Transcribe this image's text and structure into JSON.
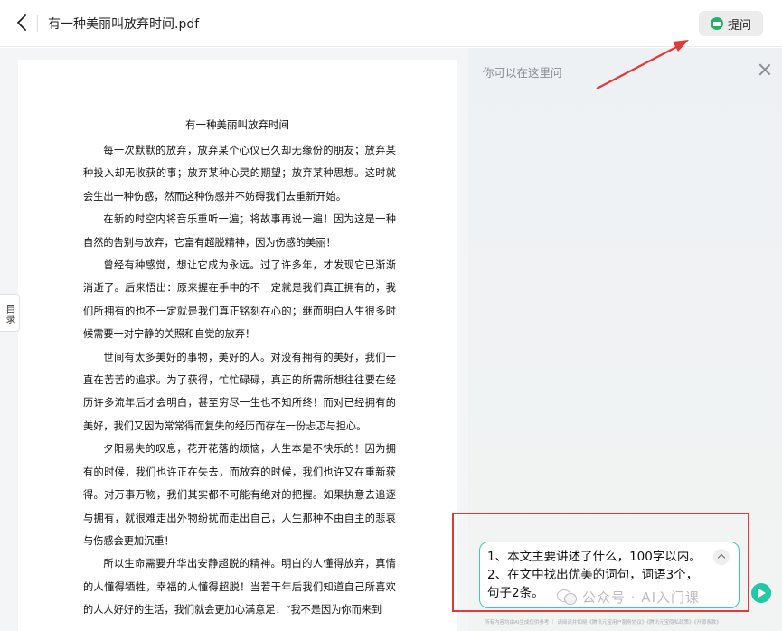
{
  "header": {
    "title": "有一种美丽叫放弃时间.pdf",
    "ask_label": "提问"
  },
  "sidebar": {
    "toc_label": "目录"
  },
  "document": {
    "heading": "有一种美丽叫放弃时间",
    "paragraphs": [
      "每一次默默的放弃，放弃某个心仪已久却无缘份的朋友；放弃某种投入却无收获的事；放弃某种心灵的期望；放弃某种思想。这时就会生出一种伤感，然而这种伤感并不妨碍我们去重新开始。",
      "在新的时空内将音乐重听一遍；将故事再说一遍！因为这是一种自然的告别与放弃，它富有超脱精神，因为伤感的美丽！",
      "曾经有种感觉，想让它成为永远。过了许多年，才发现它已渐渐消逝了。后来悟出：原来握在手中的不一定就是我们真正拥有的，我们所拥有的也不一定就是我们真正铭刻在心的；继而明白人生很多时候需要一对宁静的关照和自觉的放弃！",
      "世间有太多美好的事物，美好的人。对没有拥有的美好，我们一直在苦苦的追求。为了获得，忙忙碌碌，真正的所需所想往往要在经历许多流年后才会明白，甚至穷尽一生也不知所终！而对已经拥有的美好，我们又因为常常得而复失的经历而存在一份忐忑与担心。",
      "夕阳易失的叹息，花开花落的烦恼，人生本是不快乐的！因为拥有的时候，我们也许正在失去，而放弃的时候，我们也许又在重新获得。对万事万物，我们其实都不可能有绝对的把握。如果执意去追逐与拥有，就很难走出外物纷扰而走出自己，人生那种不由自主的悲哀与伤感会更加沉重！",
      "所以生命需要升华出安静超脱的精神。明白的人懂得放弃，真情的人懂得牺牲，幸福的人懂得超脱！当若干年后我们知道自己所喜欢的人人好好的生活，我们就会更加心满意足：“我不是因为你而来到"
    ]
  },
  "panel": {
    "hint": "你可以在这里问",
    "input_lines": [
      "1、本文主要讲述了什么，100字以内。",
      "2、在文中找出优美的词句，词语3个，",
      "句子2条。"
    ],
    "watermark": "公众号 · AI入门课",
    "footer": "所有内容均由AI生成仅供参考 ｜ 请阅读并知晓《腾讯元宝用户服务协议》《腾讯元宝隐私政策》《开源条款》"
  },
  "colors": {
    "accent": "#23b26b",
    "input_border": "#3cc9b5",
    "annotation": "#e53935"
  }
}
